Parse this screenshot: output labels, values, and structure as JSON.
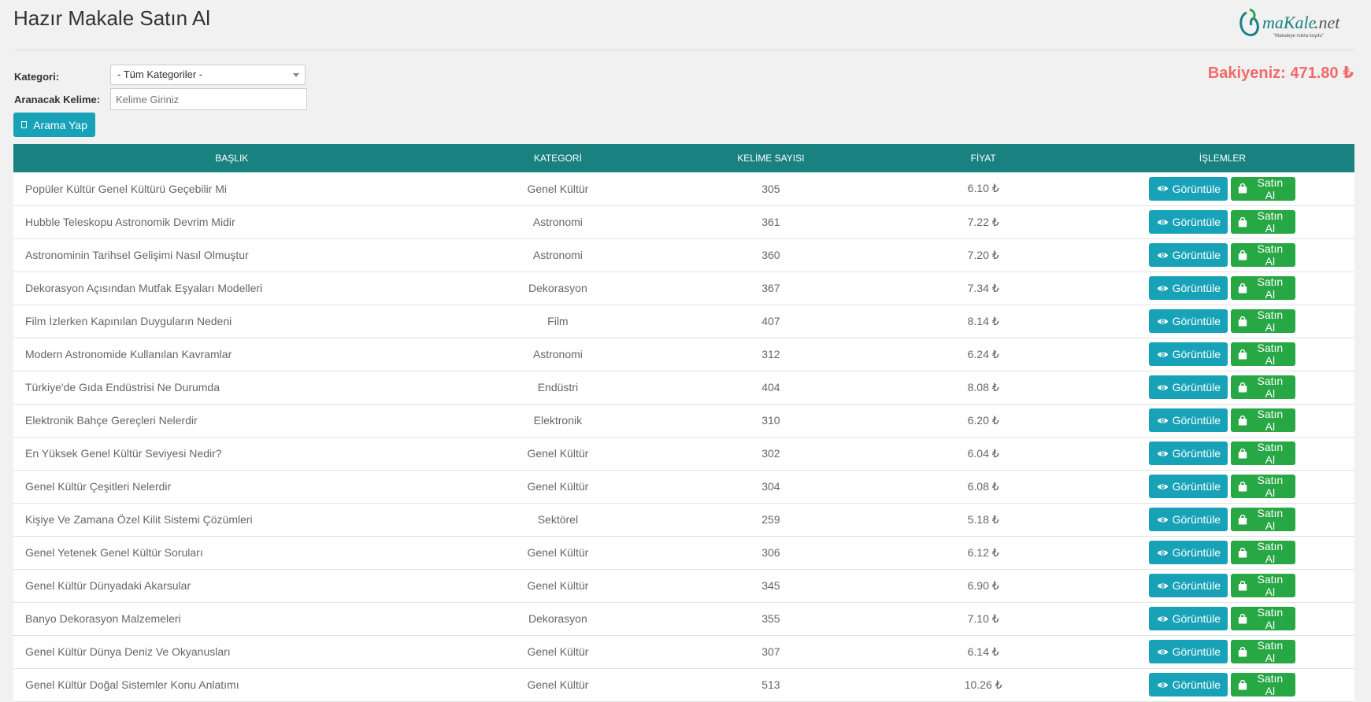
{
  "page_title": "Hazır Makale Satın Al",
  "logo": {
    "text": ".maKale.net",
    "slogan": "\"Makaleye nokta koydu\""
  },
  "balance": "Bakiyeniz: 471.80 ₺",
  "filters": {
    "category_label": "Kategori:",
    "category_value": "- Tüm Kategoriler -",
    "keyword_label": "Aranacak Kelime:",
    "keyword_placeholder": "Kelime Giriniz",
    "search_button": "Arama Yap"
  },
  "table": {
    "headers": [
      "BAŞLIK",
      "KATEGORİ",
      "KELİME SAYISI",
      "FİYAT",
      "İŞLEMLER"
    ],
    "view_label": "Görüntüle",
    "buy_label": "Satın Al",
    "rows": [
      {
        "title": "Popüler Kültür Genel Kültürü Geçebilir Mi",
        "category": "Genel Kültür",
        "words": "305",
        "price": "6.10 ₺"
      },
      {
        "title": "Hubble Teleskopu Astronomik Devrim Midir",
        "category": "Astronomi",
        "words": "361",
        "price": "7.22 ₺"
      },
      {
        "title": "Astronominin Tarihsel Gelişimi Nasıl Olmuştur",
        "category": "Astronomi",
        "words": "360",
        "price": "7.20 ₺"
      },
      {
        "title": "Dekorasyon Açısından Mutfak Eşyaları Modelleri",
        "category": "Dekorasyon",
        "words": "367",
        "price": "7.34 ₺"
      },
      {
        "title": "Film İzlerken Kapınılan Duyguların Nedeni",
        "category": "Film",
        "words": "407",
        "price": "8.14 ₺"
      },
      {
        "title": "Modern Astronomide Kullanılan Kavramlar",
        "category": "Astronomi",
        "words": "312",
        "price": "6.24 ₺"
      },
      {
        "title": "Türkiye'de Gıda Endüstrisi Ne Durumda",
        "category": "Endüstri",
        "words": "404",
        "price": "8.08 ₺"
      },
      {
        "title": "Elektronik Bahçe Gereçleri Nelerdir",
        "category": "Elektronik",
        "words": "310",
        "price": "6.20 ₺"
      },
      {
        "title": "En Yüksek Genel Kültür Seviyesi Nedir?",
        "category": "Genel Kültür",
        "words": "302",
        "price": "6.04 ₺"
      },
      {
        "title": "Genel Kültür Çeşitleri Nelerdir",
        "category": "Genel Kültür",
        "words": "304",
        "price": "6.08 ₺"
      },
      {
        "title": "Kişiye Ve Zamana Özel Kilit Sistemi Çözümleri",
        "category": "Sektörel",
        "words": "259",
        "price": "5.18 ₺"
      },
      {
        "title": "Genel Yetenek Genel Kültür Soruları",
        "category": "Genel Kültür",
        "words": "306",
        "price": "6.12 ₺"
      },
      {
        "title": "Genel Kültür Dünyadaki Akarsular",
        "category": "Genel Kültür",
        "words": "345",
        "price": "6.90 ₺"
      },
      {
        "title": "Banyo Dekorasyon Malzemeleri",
        "category": "Dekorasyon",
        "words": "355",
        "price": "7.10 ₺"
      },
      {
        "title": "Genel Kültür Dünya Deniz Ve Okyanusları",
        "category": "Genel Kültür",
        "words": "307",
        "price": "6.14 ₺"
      },
      {
        "title": "Genel Kültür Doğal Sistemler Konu Anlatımı",
        "category": "Genel Kültür",
        "words": "513",
        "price": "10.26 ₺"
      }
    ]
  },
  "colors": {
    "header_bg": "#1a8181",
    "view_button": "#17a2b8",
    "buy_button": "#28a745",
    "balance": "#f36a6a"
  }
}
